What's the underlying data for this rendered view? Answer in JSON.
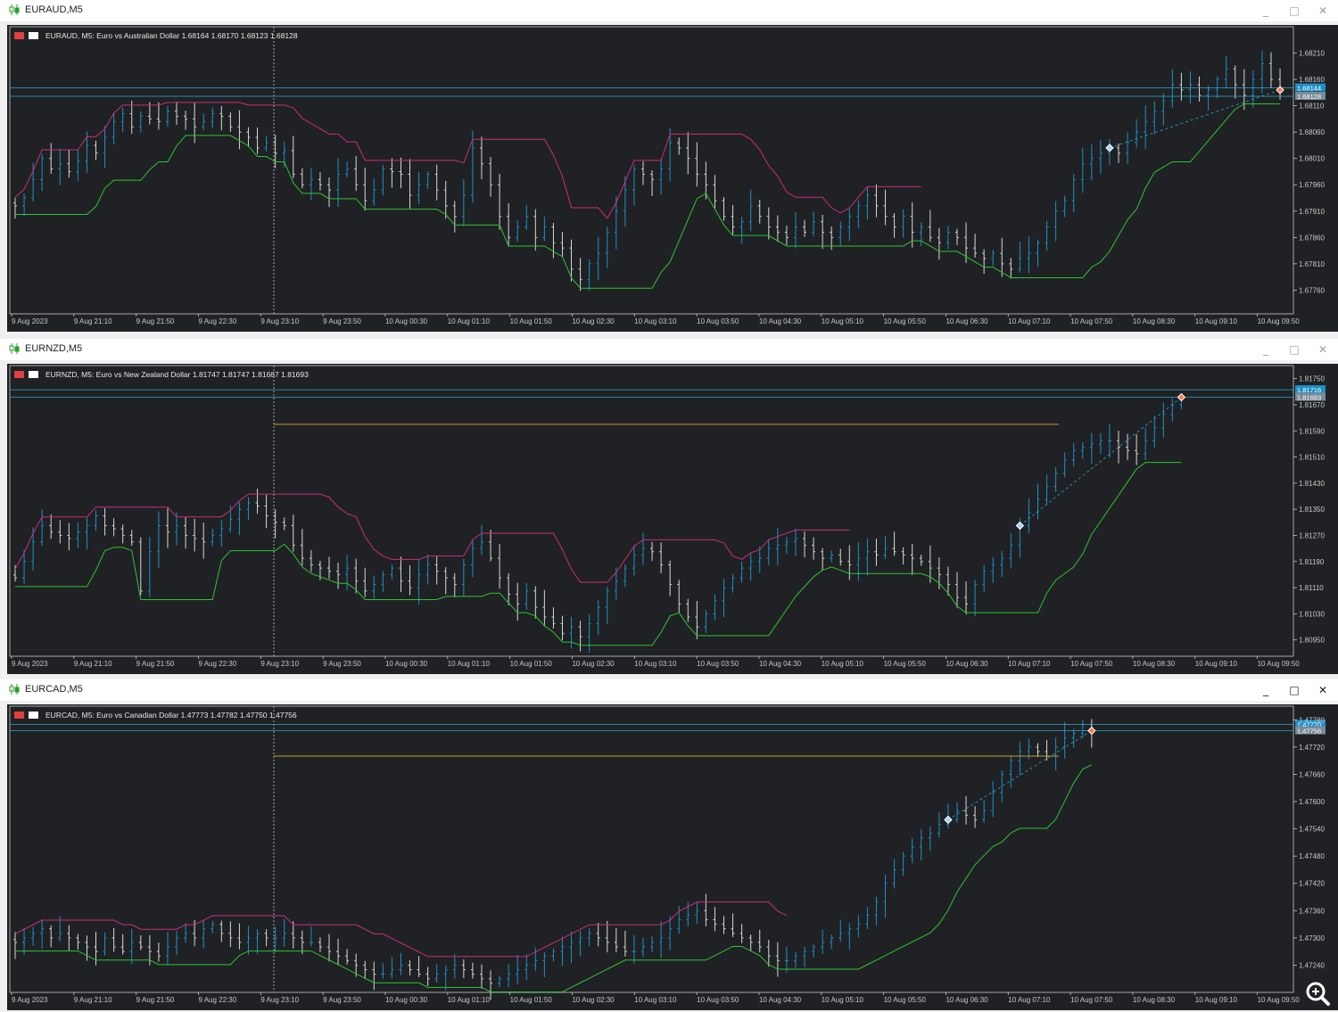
{
  "windows": [
    {
      "window_title": "EURAUD,M5",
      "header": {
        "symbol": "EURAUD, M5:",
        "description": "Euro vs Australian Dollar",
        "ohlc": "1.68164 1.68170 1.68123 1.68128"
      },
      "controls": {
        "minimize": "_",
        "maximize": "□",
        "close": "✕"
      }
    },
    {
      "window_title": "EURNZD,M5",
      "header": {
        "symbol": "EURNZD, M5:",
        "description": "Euro vs New Zealand Dollar",
        "ohlc": "1.81747 1.81747 1.81687 1.81693"
      },
      "controls": {
        "minimize": "_",
        "maximize": "□",
        "close": "✕"
      }
    },
    {
      "window_title": "EURCAD,M5",
      "header": {
        "symbol": "EURCAD, M5:",
        "description": "Euro vs Canadian Dollar",
        "ohlc": "1.47773 1.47782 1.47750 1.47756"
      },
      "controls": {
        "minimize": "_",
        "maximize": "□",
        "close": "✕"
      }
    }
  ],
  "colors": {
    "background": "#1f2124",
    "bull": "#1e90c8",
    "bear": "#d8d8d8",
    "grid_axis": "#c8c8c8",
    "level_line": "#30a8d0",
    "resistance": "#cc2d7a",
    "support": "#2fc42f",
    "horizontal_level": "#c8a028",
    "bid_label": "#1e90c8",
    "ask_label": "#7a8a96"
  },
  "icons": {
    "window": "candles-icon",
    "zoom": "magnifier-zoom-icon"
  },
  "chart_data": [
    {
      "type": "candlestick",
      "title": "EURAUD, M5: Euro vs Australian Dollar",
      "x_tick_labels": [
        "9 Aug 2023",
        "9 Aug 21:10",
        "9 Aug 21:50",
        "9 Aug 22:30",
        "9 Aug 23:10",
        "9 Aug 23:50",
        "10 Aug 00:30",
        "10 Aug 01:10",
        "10 Aug 01:50",
        "10 Aug 02:30",
        "10 Aug 03:10",
        "10 Aug 03:50",
        "10 Aug 04:30",
        "10 Aug 05:10",
        "10 Aug 05:50",
        "10 Aug 06:30",
        "10 Aug 07:10",
        "10 Aug 07:50",
        "10 Aug 08:30",
        "10 Aug 09:10",
        "10 Aug 09:50"
      ],
      "y_ticks": [
        1.6776,
        1.6781,
        1.6786,
        1.6791,
        1.6796,
        1.6801,
        1.6806,
        1.6811,
        1.6816,
        1.6821
      ],
      "ylim": [
        1.67715,
        1.6826
      ],
      "ref_prices": [
        1.68144,
        1.68128
      ],
      "price_labels": [
        "1.68144",
        "1.68128"
      ],
      "closes": [
        1.6792,
        1.67935,
        1.6797,
        1.6801,
        1.6799,
        1.68,
        1.67985,
        1.68005,
        1.68035,
        1.6802,
        1.6805,
        1.6808,
        1.68095,
        1.6807,
        1.6809,
        1.68085,
        1.6808,
        1.681,
        1.6809,
        1.68085,
        1.6807,
        1.6808,
        1.68095,
        1.6809,
        1.6807,
        1.6806,
        1.6805,
        1.6803,
        1.6804,
        1.6802,
        1.68025,
        1.6798,
        1.6796,
        1.6797,
        1.6796,
        1.6795,
        1.6798,
        1.6799,
        1.6796,
        1.6793,
        1.6795,
        1.6799,
        1.67985,
        1.6798,
        1.6794,
        1.6796,
        1.6798,
        1.6795,
        1.6792,
        1.679,
        1.6794,
        1.6803,
        1.68,
        1.6796,
        1.679,
        1.6786,
        1.6788,
        1.679,
        1.6786,
        1.6788,
        1.6785,
        1.6784,
        1.678,
        1.6778,
        1.6781,
        1.6783,
        1.6787,
        1.6791,
        1.6795,
        1.6799,
        1.6798,
        1.6797,
        1.6799,
        1.6804,
        1.6803,
        1.6801,
        1.6798,
        1.6796,
        1.6793,
        1.679,
        1.6788,
        1.6789,
        1.6792,
        1.679,
        1.6788,
        1.6787,
        1.6786,
        1.6788,
        1.6787,
        1.6789,
        1.6787,
        1.6786,
        1.6788,
        1.679,
        1.6792,
        1.6794,
        1.6792,
        1.679,
        1.6788,
        1.679,
        1.6787,
        1.6788,
        1.6786,
        1.6785,
        1.6787,
        1.6786,
        1.6784,
        1.6783,
        1.6782,
        1.6783,
        1.6781,
        1.678,
        1.6782,
        1.6783,
        1.6785,
        1.6788,
        1.6791,
        1.6793,
        1.6797,
        1.68,
        1.6801,
        1.6802,
        1.6803,
        1.6802,
        1.6804,
        1.6806,
        1.6808,
        1.681,
        1.6812,
        1.6815,
        1.6814,
        1.6815,
        1.6813,
        1.6814,
        1.6816,
        1.6818,
        1.6815,
        1.6813,
        1.6816,
        1.6819,
        1.6816,
        1.6814,
        1.6815,
        1.68128
      ]
    },
    {
      "type": "candlestick",
      "title": "EURNZD, M5: Euro vs New Zealand Dollar",
      "x_tick_labels": [
        "9 Aug 2023",
        "9 Aug 21:10",
        "9 Aug 21:50",
        "9 Aug 22:30",
        "9 Aug 23:10",
        "9 Aug 23:50",
        "10 Aug 00:30",
        "10 Aug 01:10",
        "10 Aug 01:50",
        "10 Aug 02:30",
        "10 Aug 03:10",
        "10 Aug 03:50",
        "10 Aug 04:30",
        "10 Aug 05:10",
        "10 Aug 05:50",
        "10 Aug 06:30",
        "10 Aug 07:10",
        "10 Aug 07:50",
        "10 Aug 08:30",
        "10 Aug 09:10",
        "10 Aug 09:50"
      ],
      "y_ticks": [
        1.8095,
        1.8103,
        1.8111,
        1.8119,
        1.8127,
        1.8135,
        1.8143,
        1.8151,
        1.8159,
        1.8167,
        1.8175
      ],
      "ylim": [
        1.809,
        1.8179
      ],
      "ref_prices": [
        1.81716,
        1.81693
      ],
      "price_labels": [
        "1.81716",
        "1.81693"
      ],
      "horizontal_level": 1.8161,
      "closes": [
        1.8114,
        1.8119,
        1.8125,
        1.813,
        1.8128,
        1.8127,
        1.8126,
        1.8128,
        1.813,
        1.8133,
        1.813,
        1.8129,
        1.8127,
        1.8125,
        1.811,
        1.8122,
        1.813,
        1.8128,
        1.813,
        1.8127,
        1.8126,
        1.8125,
        1.8127,
        1.8129,
        1.8132,
        1.8135,
        1.8137,
        1.8136,
        1.8133,
        1.8131,
        1.813,
        1.8124,
        1.812,
        1.8118,
        1.8117,
        1.8116,
        1.8115,
        1.8117,
        1.8113,
        1.811,
        1.8112,
        1.8115,
        1.8117,
        1.8113,
        1.8111,
        1.8115,
        1.8118,
        1.8116,
        1.8114,
        1.8112,
        1.8118,
        1.8123,
        1.8125,
        1.812,
        1.8114,
        1.8109,
        1.8106,
        1.811,
        1.8105,
        1.8102,
        1.81,
        1.8097,
        1.8099,
        1.8096,
        1.81,
        1.8105,
        1.811,
        1.8113,
        1.8117,
        1.8121,
        1.8123,
        1.8122,
        1.8118,
        1.8112,
        1.8106,
        1.8102,
        1.8099,
        1.8103,
        1.8107,
        1.8111,
        1.8114,
        1.8117,
        1.8119,
        1.812,
        1.8123,
        1.8124,
        1.8125,
        1.8126,
        1.8124,
        1.8122,
        1.812,
        1.8121,
        1.8119,
        1.8118,
        1.812,
        1.8122,
        1.8121,
        1.8123,
        1.8122,
        1.8121,
        1.812,
        1.8119,
        1.8117,
        1.8115,
        1.8112,
        1.8108,
        1.8106,
        1.8112,
        1.8116,
        1.8118,
        1.812,
        1.8124,
        1.813,
        1.8134,
        1.8138,
        1.8142,
        1.8146,
        1.815,
        1.8153,
        1.8154,
        1.8155,
        1.8156,
        1.8156,
        1.8154,
        1.8153,
        1.8152,
        1.8156,
        1.816,
        1.8164,
        1.8167,
        1.81693
      ]
    },
    {
      "type": "candlestick",
      "title": "EURCAD, M5: Euro vs Canadian Dollar",
      "x_tick_labels": [
        "9 Aug 2023",
        "9 Aug 21:10",
        "9 Aug 21:50",
        "9 Aug 22:30",
        "9 Aug 23:10",
        "9 Aug 23:50",
        "10 Aug 00:30",
        "10 Aug 01:10",
        "10 Aug 01:50",
        "10 Aug 02:30",
        "10 Aug 03:10",
        "10 Aug 03:50",
        "10 Aug 04:30",
        "10 Aug 05:10",
        "10 Aug 05:50",
        "10 Aug 06:30",
        "10 Aug 07:10",
        "10 Aug 07:50",
        "10 Aug 08:30",
        "10 Aug 09:10",
        "10 Aug 09:50"
      ],
      "y_ticks": [
        1.4724,
        1.473,
        1.4736,
        1.4742,
        1.4748,
        1.4754,
        1.476,
        1.4766,
        1.4772,
        1.4778
      ],
      "ylim": [
        1.4718,
        1.4781
      ],
      "ref_prices": [
        1.4777,
        1.47756
      ],
      "price_labels": [
        "1.47770",
        "1.47756"
      ],
      "horizontal_level": 1.477,
      "closes": [
        1.4729,
        1.473,
        1.4731,
        1.4732,
        1.473,
        1.4731,
        1.473,
        1.4729,
        1.4728,
        1.4727,
        1.473,
        1.4728,
        1.4727,
        1.4729,
        1.4728,
        1.4727,
        1.4726,
        1.4728,
        1.473,
        1.4731,
        1.473,
        1.4732,
        1.4733,
        1.4731,
        1.473,
        1.4729,
        1.473,
        1.4731,
        1.473,
        1.473,
        1.4731,
        1.473,
        1.4729,
        1.4729,
        1.4728,
        1.4727,
        1.4726,
        1.4725,
        1.4724,
        1.4723,
        1.4722,
        1.4722,
        1.4723,
        1.4724,
        1.4723,
        1.4722,
        1.4721,
        1.4722,
        1.4723,
        1.4724,
        1.4723,
        1.4722,
        1.4721,
        1.472,
        1.4721,
        1.4722,
        1.4723,
        1.4724,
        1.4725,
        1.4726,
        1.4727,
        1.4728,
        1.4729,
        1.473,
        1.4731,
        1.473,
        1.4729,
        1.4728,
        1.4727,
        1.4727,
        1.4728,
        1.4729,
        1.473,
        1.4732,
        1.4734,
        1.4735,
        1.4736,
        1.4734,
        1.4733,
        1.4732,
        1.4731,
        1.473,
        1.4729,
        1.4728,
        1.4726,
        1.4725,
        1.4725,
        1.4726,
        1.4727,
        1.4728,
        1.4729,
        1.473,
        1.4731,
        1.4732,
        1.4733,
        1.4735,
        1.4738,
        1.4742,
        1.4745,
        1.4748,
        1.475,
        1.4752,
        1.4753,
        1.4755,
        1.4756,
        1.4758,
        1.4757,
        1.4756,
        1.4758,
        1.4762,
        1.4766,
        1.4769,
        1.4771,
        1.4772,
        1.4771,
        1.477,
        1.4772,
        1.4774,
        1.4775,
        1.4777,
        1.47756
      ]
    }
  ]
}
